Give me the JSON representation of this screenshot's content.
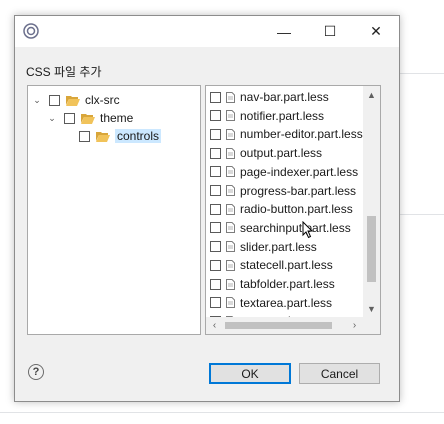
{
  "window": {
    "icon": "css-file-icon",
    "minimize_glyph": "—",
    "maximize_glyph": "☐",
    "close_glyph": "✕"
  },
  "caption": "CSS 파일 추가",
  "tree": [
    {
      "label": "clx-src",
      "expanded": true,
      "checked": false,
      "level": 0
    },
    {
      "label": "theme",
      "expanded": true,
      "checked": false,
      "level": 1
    },
    {
      "label": "controls",
      "expanded": false,
      "checked": false,
      "level": 2,
      "selected": true
    }
  ],
  "files": [
    {
      "label": "nav-bar.part.less",
      "checked": false
    },
    {
      "label": "notifier.part.less",
      "checked": false
    },
    {
      "label": "number-editor.part.less",
      "checked": false
    },
    {
      "label": "output.part.less",
      "checked": false
    },
    {
      "label": "page-indexer.part.less",
      "checked": false
    },
    {
      "label": "progress-bar.part.less",
      "checked": false
    },
    {
      "label": "radio-button.part.less",
      "checked": false
    },
    {
      "label": "searchinput.part.less",
      "checked": false
    },
    {
      "label": "slider.part.less",
      "checked": false
    },
    {
      "label": "statecell.part.less",
      "checked": false
    },
    {
      "label": "tabfolder.part.less",
      "checked": false
    },
    {
      "label": "textarea.part.less",
      "checked": false
    },
    {
      "label": "tree.part.less",
      "checked": false
    }
  ],
  "scroll": {
    "up_glyph": "▲",
    "down_glyph": "▼",
    "left_glyph": "‹",
    "right_glyph": "›"
  },
  "buttons": {
    "help": "?",
    "ok": "OK",
    "cancel": "Cancel"
  },
  "colors": {
    "folder": "#e8b84a",
    "selection": "#cce8ff",
    "default_button_border": "#0078d7"
  }
}
